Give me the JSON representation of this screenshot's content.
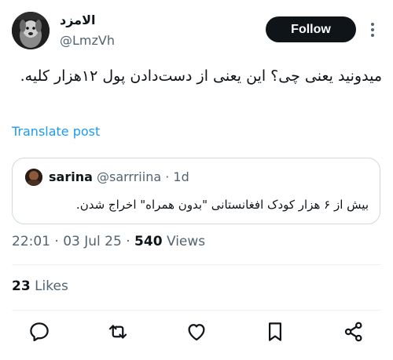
{
  "author": {
    "display_name": "الامزد",
    "handle": "@LmzVh",
    "avatar_icon": "dog-photo-avatar"
  },
  "follow_label": "Follow",
  "more_icon": "more-vertical-icon",
  "tweet": {
    "text": "میدونید یعنی چی؟ این یعنی از دست‌دادن پول ۱۲هزار کلیه."
  },
  "translate_label": "Translate post",
  "quote": {
    "name": "sarina",
    "handle": "@sarrriina",
    "separator": "·",
    "time": "1d",
    "text": "بیش از ۶ هزار کودک افغانستانی \"بدون همراه\" اخراج شدن."
  },
  "meta": {
    "time": "22:01",
    "separator_1": "·",
    "date": "03 Jul 25",
    "separator_2": "·",
    "views_count": "540",
    "views_label": "Views"
  },
  "likes": {
    "count": "23",
    "label": "Likes"
  },
  "actions": [
    "reply-icon",
    "repost-icon",
    "like-icon",
    "bookmark-icon",
    "share-icon"
  ],
  "colors": {
    "accent": "#1d9bf0",
    "text": "#0f1419",
    "secondary": "#536471",
    "border": "#cfd9de"
  }
}
